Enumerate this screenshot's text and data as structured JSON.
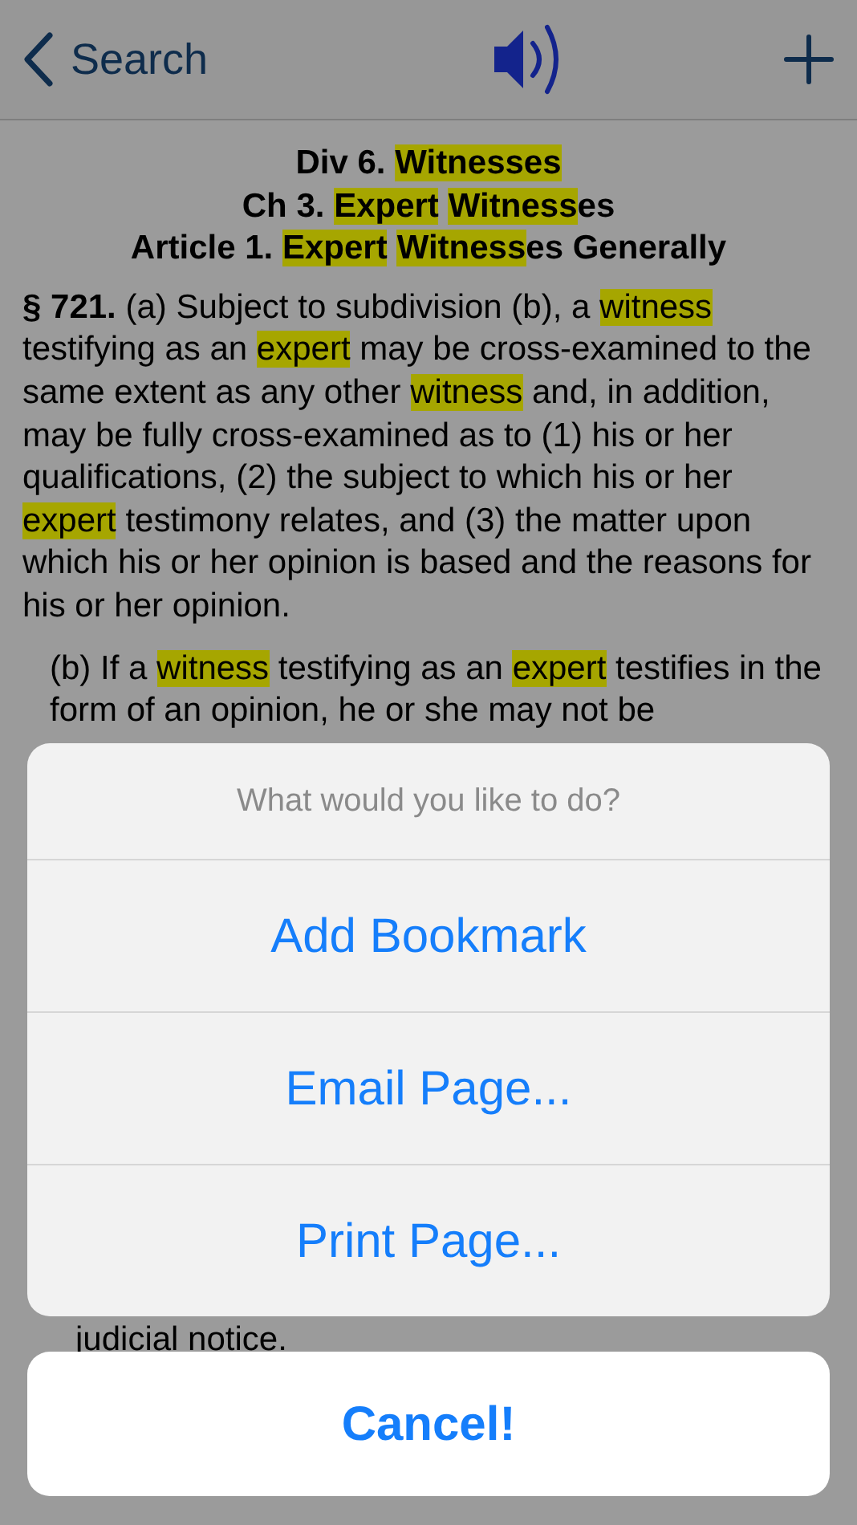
{
  "nav_bar": {
    "back_label": "Search"
  },
  "document": {
    "headings": [
      [
        {
          "text": "Div 6. ",
          "highlighted": false
        },
        {
          "text": "Witnesses",
          "highlighted": true
        }
      ],
      [
        {
          "text": "Ch 3. ",
          "highlighted": false
        },
        {
          "text": "Expert",
          "highlighted": true
        },
        {
          "text": "Witness",
          "highlighted": true
        },
        {
          "text": "es",
          "highlighted": false
        }
      ],
      [
        {
          "text": "Article 1. ",
          "highlighted": false
        },
        {
          "text": "Expert",
          "highlighted": true
        },
        {
          "text": "Witness",
          "highlighted": true
        },
        {
          "text": "es Generally",
          "highlighted": false
        }
      ]
    ],
    "section_number": "§ 721.",
    "paragraph_a": [
      {
        "text": " (a) Subject to subdivision (b), a ",
        "highlighted": false
      },
      {
        "text": "witness",
        "highlighted": true
      },
      {
        "text": " testifying as an ",
        "highlighted": false
      },
      {
        "text": "expert",
        "highlighted": true
      },
      {
        "text": " may be cross-examined to the same extent as any other ",
        "highlighted": false
      },
      {
        "text": "witness",
        "highlighted": true
      },
      {
        "text": " and, in addition, may be fully cross-examined as to (1) his or her qualifications, (2) the subject to which his or her ",
        "highlighted": false
      },
      {
        "text": "expert",
        "highlighted": true
      },
      {
        "text": " testimony relates, and (3) the matter upon which his or her opinion is based and the reasons for his or her opinion.",
        "highlighted": false
      }
    ],
    "paragraph_b": [
      {
        "text": "(b) If a ",
        "highlighted": false
      },
      {
        "text": "witness",
        "highlighted": true
      },
      {
        "text": " testifying as an ",
        "highlighted": false
      },
      {
        "text": "expert",
        "highlighted": true
      },
      {
        "text": " testifies in the form of an opinion, he or she may not be",
        "highlighted": false
      }
    ],
    "visible_tail": "judicial notice."
  },
  "action_sheet": {
    "title": "What would you like to do?",
    "actions": [
      "Add Bookmark",
      "Email Page...",
      "Print Page..."
    ],
    "cancel": "Cancel!"
  }
}
